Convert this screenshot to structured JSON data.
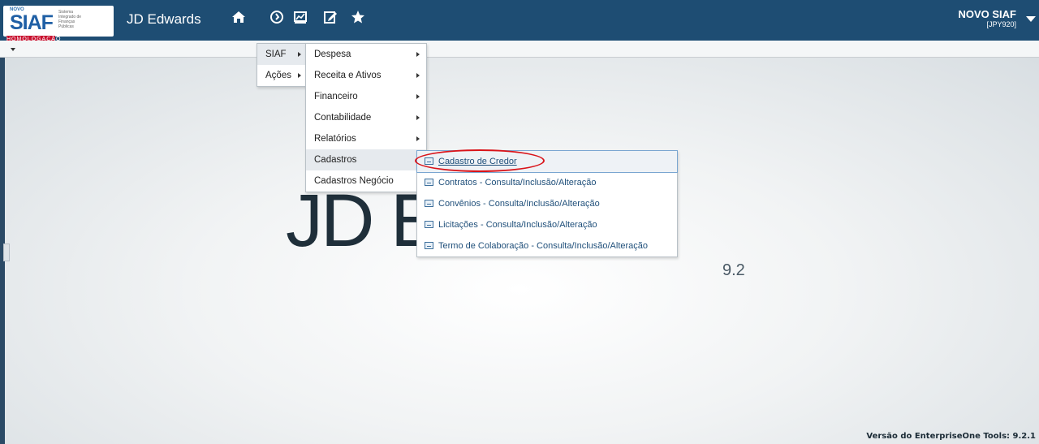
{
  "header": {
    "logo": {
      "novo": "NOVO",
      "siaf": "SIAF",
      "sub": "Sistema Integrado de Finanças Públicas",
      "homolog": "HOMOLOGAÇÃO"
    },
    "app_name": "JD Edwards",
    "nav_icons": [
      "home-icon",
      "recent-icon",
      "dashboard-icon",
      "edit-icon",
      "favorites-star-icon"
    ],
    "user": {
      "name": "NOVO SIAF",
      "env": "[JPY920]"
    }
  },
  "menus": {
    "level1": [
      {
        "label": "SIAF"
      },
      {
        "label": "Ações"
      }
    ],
    "level2": [
      {
        "label": "Despesa"
      },
      {
        "label": "Receita e Ativos"
      },
      {
        "label": "Financeiro"
      },
      {
        "label": "Contabilidade"
      },
      {
        "label": "Relatórios"
      },
      {
        "label": "Cadastros"
      },
      {
        "label": "Cadastros Negócio"
      }
    ],
    "level3": [
      {
        "label": "Cadastro de Credor"
      },
      {
        "label": "Contratos - Consulta/Inclusão/Alteração"
      },
      {
        "label": "Convênios - Consulta/Inclusão/Alteração"
      },
      {
        "label": "Licitações - Consulta/Inclusão/Alteração"
      },
      {
        "label": "Termo de Colaboração - Consulta/Inclusão/Alteração"
      }
    ]
  },
  "background": {
    "brand_text": "JD E    DS",
    "version": "9.2"
  },
  "footer": {
    "tools_version": "Versão do EnterpriseOne Tools: 9.2.1"
  },
  "colors": {
    "header_bg": "#1e4d73",
    "highlight_circle": "#d9141a"
  }
}
